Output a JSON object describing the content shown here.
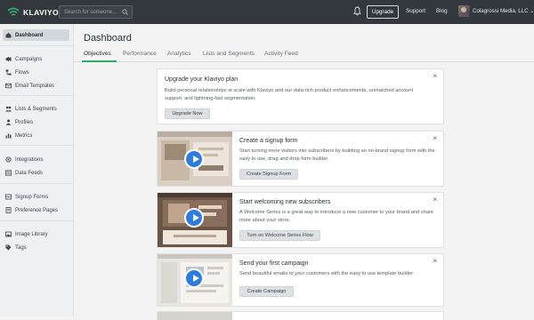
{
  "topbar": {
    "brand": "KLAVIYO",
    "search_placeholder": "Search for someone...",
    "upgrade_label": "Upgrade",
    "support_label": "Support",
    "blog_label": "Blog",
    "account_name": "Colagrossi Media, LLC",
    "account_chevron": "⌄"
  },
  "sidebar": {
    "items": [
      {
        "label": "Dashboard",
        "icon": "dashboard-icon",
        "active": true
      },
      {
        "label": "Campaigns",
        "icon": "campaigns-icon"
      },
      {
        "label": "Flows",
        "icon": "flows-icon"
      },
      {
        "label": "Email Templates",
        "icon": "email-templates-icon"
      },
      {
        "label": "Lists & Segments",
        "icon": "lists-segments-icon"
      },
      {
        "label": "Profiles",
        "icon": "profiles-icon"
      },
      {
        "label": "Metrics",
        "icon": "metrics-icon"
      },
      {
        "label": "Integrations",
        "icon": "integrations-icon"
      },
      {
        "label": "Data Feeds",
        "icon": "data-feeds-icon"
      },
      {
        "label": "Signup Forms",
        "icon": "signup-forms-icon"
      },
      {
        "label": "Preference Pages",
        "icon": "preference-pages-icon"
      },
      {
        "label": "Image Library",
        "icon": "image-library-icon"
      },
      {
        "label": "Tags",
        "icon": "tags-icon"
      }
    ]
  },
  "main": {
    "title": "Dashboard",
    "tabs": [
      {
        "label": "Objectives",
        "active": true
      },
      {
        "label": "Performance"
      },
      {
        "label": "Analytics"
      },
      {
        "label": "Lists and Segments"
      },
      {
        "label": "Activity Feed"
      }
    ]
  },
  "cards": {
    "upgrade": {
      "title": "Upgrade your Klaviyo plan",
      "description": "Build personal relationships at scale with Klaviyo and our data-rich product enhancements, unmatched account support, and lightning-fast segmentation.",
      "button": "Upgrade Now",
      "close": "×"
    },
    "signup": {
      "title": "Create a signup form",
      "description": "Start turning more visitors into subscribers by building an on-brand signup form with the easy to use, drag and drop form builder.",
      "button": "Create Signup Form",
      "close": "×"
    },
    "welcome": {
      "title": "Start welcoming new subscribers",
      "description": "A Welcome Series is a great way to introduce a new customer to your brand and share more about your store.",
      "button": "Turn on Welcome Series Flow",
      "close": "×"
    },
    "campaign": {
      "title": "Send your first campaign",
      "description": "Send beautiful emails to your customers with the easy to use template builder.",
      "button": "Create Campaign",
      "close": "×"
    }
  },
  "colors": {
    "topbar": "#33383e",
    "accent_green": "#2eaa6b",
    "play_blue": "#2f7ce0"
  }
}
